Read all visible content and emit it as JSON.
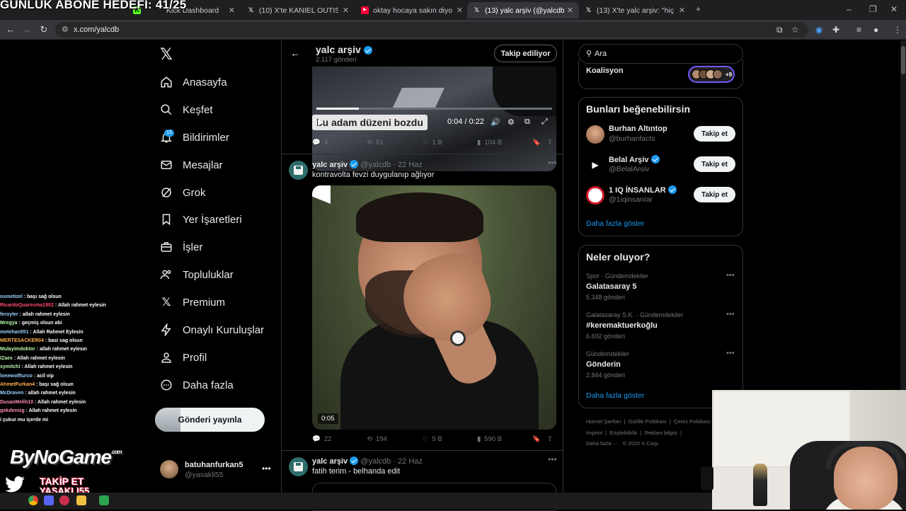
{
  "overlay": {
    "goal_text": "GÜNLÜK ABONE HEDEFİ: 41/25"
  },
  "browser": {
    "tabs": [
      {
        "label": "Kick Dashboard",
        "icon": "kick-icon",
        "active": false
      },
      {
        "label": "(10) X'te KANIEL OUTIS 😈: \"Ö...",
        "icon": "x-icon",
        "active": false
      },
      {
        "label": "oktay hocaya sakın diyor - YouT",
        "icon": "youtube-icon",
        "active": false
      },
      {
        "label": "(13) yalc arşiv (@yalcdb) / X",
        "icon": "x-icon",
        "active": true
      },
      {
        "label": "(13) X'te yalc arşiv: \"hiç ışık yok",
        "icon": "x-icon",
        "active": false
      }
    ],
    "url": "x.com/yalcdb"
  },
  "sidebar": {
    "items": [
      {
        "label": "Anasayfa",
        "icon": "home-icon"
      },
      {
        "label": "Keşfet",
        "icon": "search-icon"
      },
      {
        "label": "Bildirimler",
        "icon": "bell-icon",
        "badge": "13"
      },
      {
        "label": "Mesajlar",
        "icon": "mail-icon"
      },
      {
        "label": "Grok",
        "icon": "grok-icon"
      },
      {
        "label": "Yer İşaretleri",
        "icon": "bookmark-icon"
      },
      {
        "label": "İşler",
        "icon": "briefcase-icon"
      },
      {
        "label": "Topluluklar",
        "icon": "people-icon"
      },
      {
        "label": "Premium",
        "icon": "x-premium-icon"
      },
      {
        "label": "Onaylı Kuruluşlar",
        "icon": "lightning-icon"
      },
      {
        "label": "Profil",
        "icon": "person-icon"
      },
      {
        "label": "Daha fazla",
        "icon": "more-circle-icon"
      }
    ],
    "post_button": "Gönderi yayınla",
    "account": {
      "name": "batuhanfurkan5",
      "handle": "@yasakli55"
    }
  },
  "profile_header": {
    "name": "yalc arşiv",
    "post_count": "2.117 gönderi",
    "follow_button": "Takip ediliyor"
  },
  "tweets": [
    {
      "video_caption": "bu adam düzeni bozdu",
      "video_time": "0:04 / 0:22",
      "replies": "4",
      "reposts": "51",
      "likes": "1 B",
      "views": "104 B"
    },
    {
      "name": "yalc arşiv",
      "handle": "@yalcdb",
      "date": "22 Haz",
      "text": "kontravolta fevzi duygulanıp ağlıyor",
      "video_duration": "0:05",
      "replies": "22",
      "reposts": "194",
      "likes": "5 B",
      "views": "590 B"
    },
    {
      "name": "yalc arşiv",
      "handle": "@yalcdb",
      "date": "22 Haz",
      "text": "fatih terim - belhanda edit"
    }
  ],
  "right": {
    "search_placeholder": "Ara",
    "coalition": {
      "label": "Koalisyon",
      "extra": "+9"
    },
    "who_to_follow": {
      "title": "Bunları beğenebilirsin",
      "accounts": [
        {
          "name": "Burhan Altıntop",
          "handle": "@burhanfacts",
          "button": "Takip et"
        },
        {
          "name": "Belal Arşiv",
          "handle": "@BelalArsiv",
          "button": "Takip et"
        },
        {
          "name": "1 IQ İNSANLAR",
          "handle": "@1iqinsanIar",
          "button": "Takip et"
        }
      ],
      "show_more": "Daha fazla göster"
    },
    "trends": {
      "title": "Neler oluyor?",
      "items": [
        {
          "context": "Spor · Gündemdekiler",
          "topic": "Galatasaray 5",
          "posts": "5.348 gönderi"
        },
        {
          "context": "Galatasaray S.K. · Gündemdekiler",
          "topic": "#keremaktuerkoğlu",
          "posts": "6.692 gönderi"
        },
        {
          "context": "Gündemdekiler",
          "topic": "Gönderin",
          "posts": "2.844 gönderi"
        }
      ],
      "show_more": "Daha fazla göster"
    },
    "footer": {
      "line1": [
        "Hizmet Şartları",
        "Gizlilik Politikası",
        "Çerez Politikası"
      ],
      "line2": [
        "Imprint",
        "Erişilebilirlik",
        "Reklam bilgisi"
      ],
      "line3": [
        "Daha fazla ···",
        "© 2025 X Corp."
      ]
    }
  },
  "chat": [
    {
      "user": "osmetizel",
      "msg": "başı sağ olsun",
      "color": "#9ad0ff"
    },
    {
      "user": "RicardoQuaresma1902",
      "msg": "Allah rahmet eylesin",
      "color": "#ff4d6d"
    },
    {
      "user": "feroyler",
      "msg": "allah rahmet eylesin",
      "color": "#9ad0ff"
    },
    {
      "user": "Mregya",
      "msg": "geçmiş olsun abi",
      "color": "#b7f7a8"
    },
    {
      "user": "metehan551",
      "msg": "Allah Rahmet Eylesin",
      "color": "#9ad0ff"
    },
    {
      "user": "MERTESACKER04",
      "msg": "basi sag olsun",
      "color": "#ffb14d"
    },
    {
      "user": "Mulayimdoktor",
      "msg": "allah rahmet eylesın",
      "color": "#b7f7a8"
    },
    {
      "user": "IZaex",
      "msg": "Allah rahmet eylesin",
      "color": "#b7f7a8"
    },
    {
      "user": "symitchi",
      "msg": "Allah rahmet eylesin",
      "color": "#b7f7a8"
    },
    {
      "user": "lonewolfturco",
      "msg": "acil vip",
      "color": "#9ad0ff"
    },
    {
      "user": "AhmetFurkan4",
      "msg": "başı sağ olsun",
      "color": "#ffb14d"
    },
    {
      "user": "McDraven",
      "msg": "allah rahmet eylesin",
      "color": "#9ad0ff"
    },
    {
      "user": "DusanMelih10",
      "msg": "Allah rahmet eylesin",
      "color": "#ff8fb1"
    },
    {
      "user": "gokdenizg",
      "msg": "Allah rahmet eylesin",
      "color": "#ff8fb1"
    },
    {
      "user": "",
      "msg": "i çukur mu içerde mi",
      "color": "#ffffff"
    }
  ],
  "branding": {
    "logo": "ByNoGame",
    "logo_suffix": ".com",
    "cta_line1": "TAKİP ET",
    "cta_line2": "YASAKLI55"
  },
  "colors": {
    "accent": "#1d9bf0",
    "background": "#000000",
    "border": "#2f3336",
    "muted": "#71767b"
  }
}
